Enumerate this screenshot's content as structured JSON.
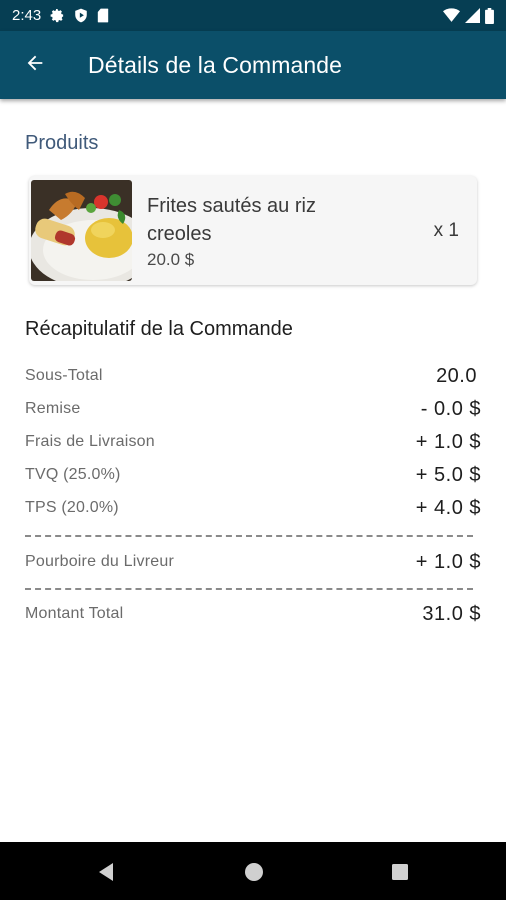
{
  "status_bar": {
    "time": "2:43",
    "left_icons": [
      "gear-icon",
      "shield-play-icon",
      "sd-card-icon"
    ],
    "right_icons": [
      "wifi-icon",
      "cell-signal-icon",
      "battery-icon"
    ]
  },
  "app_bar": {
    "back_icon": "arrow-left-icon",
    "title": "Détails de la Commande"
  },
  "colors": {
    "status_bar": "#063e53",
    "app_bar": "#0b4f69",
    "section_heading": "#405a7a"
  },
  "products_section": {
    "title": "Produits",
    "items": [
      {
        "name": "Frites sautés au riz creoles",
        "price": "20.0 $",
        "quantity": "x 1"
      }
    ]
  },
  "summary": {
    "title": "Récapitulatif de la Commande",
    "rows": [
      {
        "label": "Sous-Total",
        "value": "20.0"
      },
      {
        "label": "Remise",
        "value": "- 0.0 $"
      },
      {
        "label": "Frais de Livraison",
        "value": "+ 1.0 $"
      },
      {
        "label": "TVQ (25.0%)",
        "value": "+ 5.0 $"
      },
      {
        "label": "TPS (20.0%)",
        "value": "+ 4.0 $"
      }
    ],
    "tip": {
      "label": "Pourboire du Livreur",
      "value": "+ 1.0 $"
    },
    "total": {
      "label": "Montant Total",
      "value": "31.0 $"
    }
  },
  "nav_bar": {
    "buttons": [
      "back-triangle-icon",
      "home-circle-icon",
      "recents-square-icon"
    ]
  }
}
